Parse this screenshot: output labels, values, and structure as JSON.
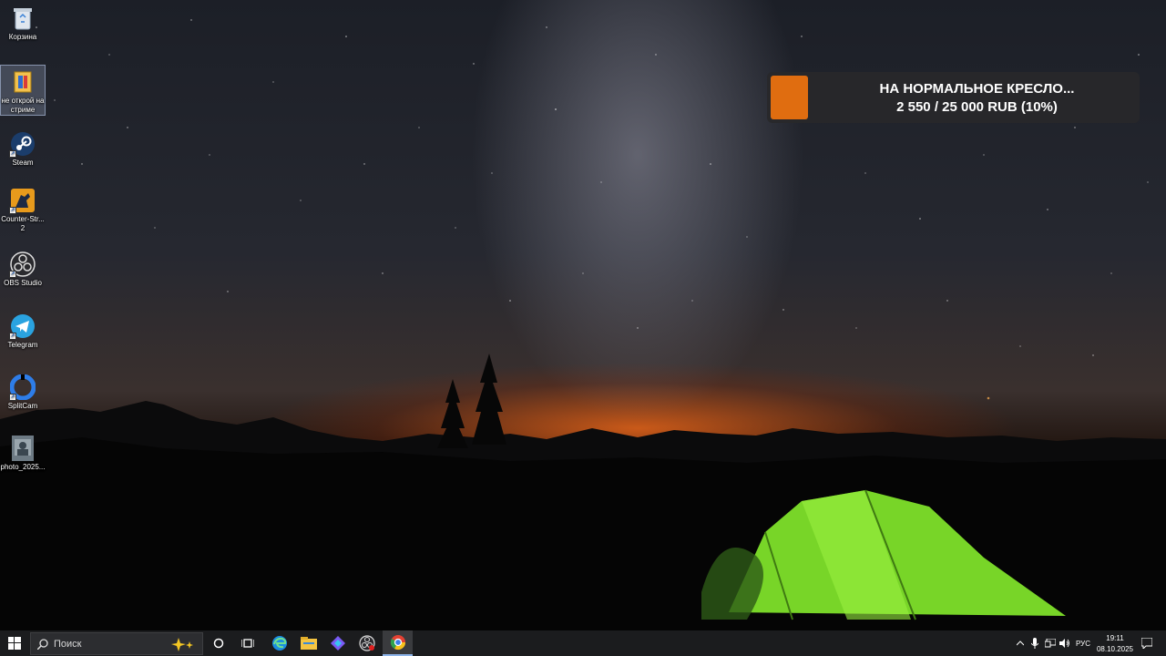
{
  "desktop": {
    "icons": [
      {
        "label": "Корзина",
        "icon": "recycle-bin-icon"
      },
      {
        "label": "не открой на стриме",
        "icon": "file-icon"
      },
      {
        "label": "Steam",
        "icon": "steam-icon"
      },
      {
        "label": "Counter-Strike 2",
        "icon": "counter-strike-icon"
      },
      {
        "label": "OBS Studio",
        "icon": "obs-icon"
      },
      {
        "label": "Telegram",
        "icon": "telegram-icon"
      },
      {
        "label": "SplitCam",
        "icon": "splitcam-icon"
      },
      {
        "label": "photo_2025...",
        "icon": "photo-icon"
      }
    ],
    "icon_labels": {
      "recycle": "Корзина",
      "secret_1": "не открой на",
      "secret_2": "стриме",
      "steam": "Steam",
      "cs_1": "Counter-Str...",
      "cs_2": "2",
      "obs": "OBS Studio",
      "telegram": "Telegram",
      "splitcam": "SplitCam",
      "photo": "photo_2025..."
    }
  },
  "donation": {
    "title": "НА НОРМАЛЬНОЕ КРЕСЛО...",
    "amount": "2 550 / 25 000 RUB (10%)",
    "progress_percent": 10,
    "bar_color": "#e06d10"
  },
  "taskbar": {
    "search_placeholder": "Поиск",
    "apps": [
      "start-icon",
      "search-icon",
      "cortana-icon",
      "task-view-icon",
      "edge-icon",
      "file-explorer-icon",
      "copilot-icon",
      "obs-icon",
      "chrome-icon"
    ],
    "tray": {
      "language": "РУС",
      "time": "19:11",
      "date": "08.10.2025"
    }
  },
  "colors": {
    "accent": "#e06d10",
    "taskbar": "#1b1c1e",
    "tent": "#7ee02a"
  }
}
